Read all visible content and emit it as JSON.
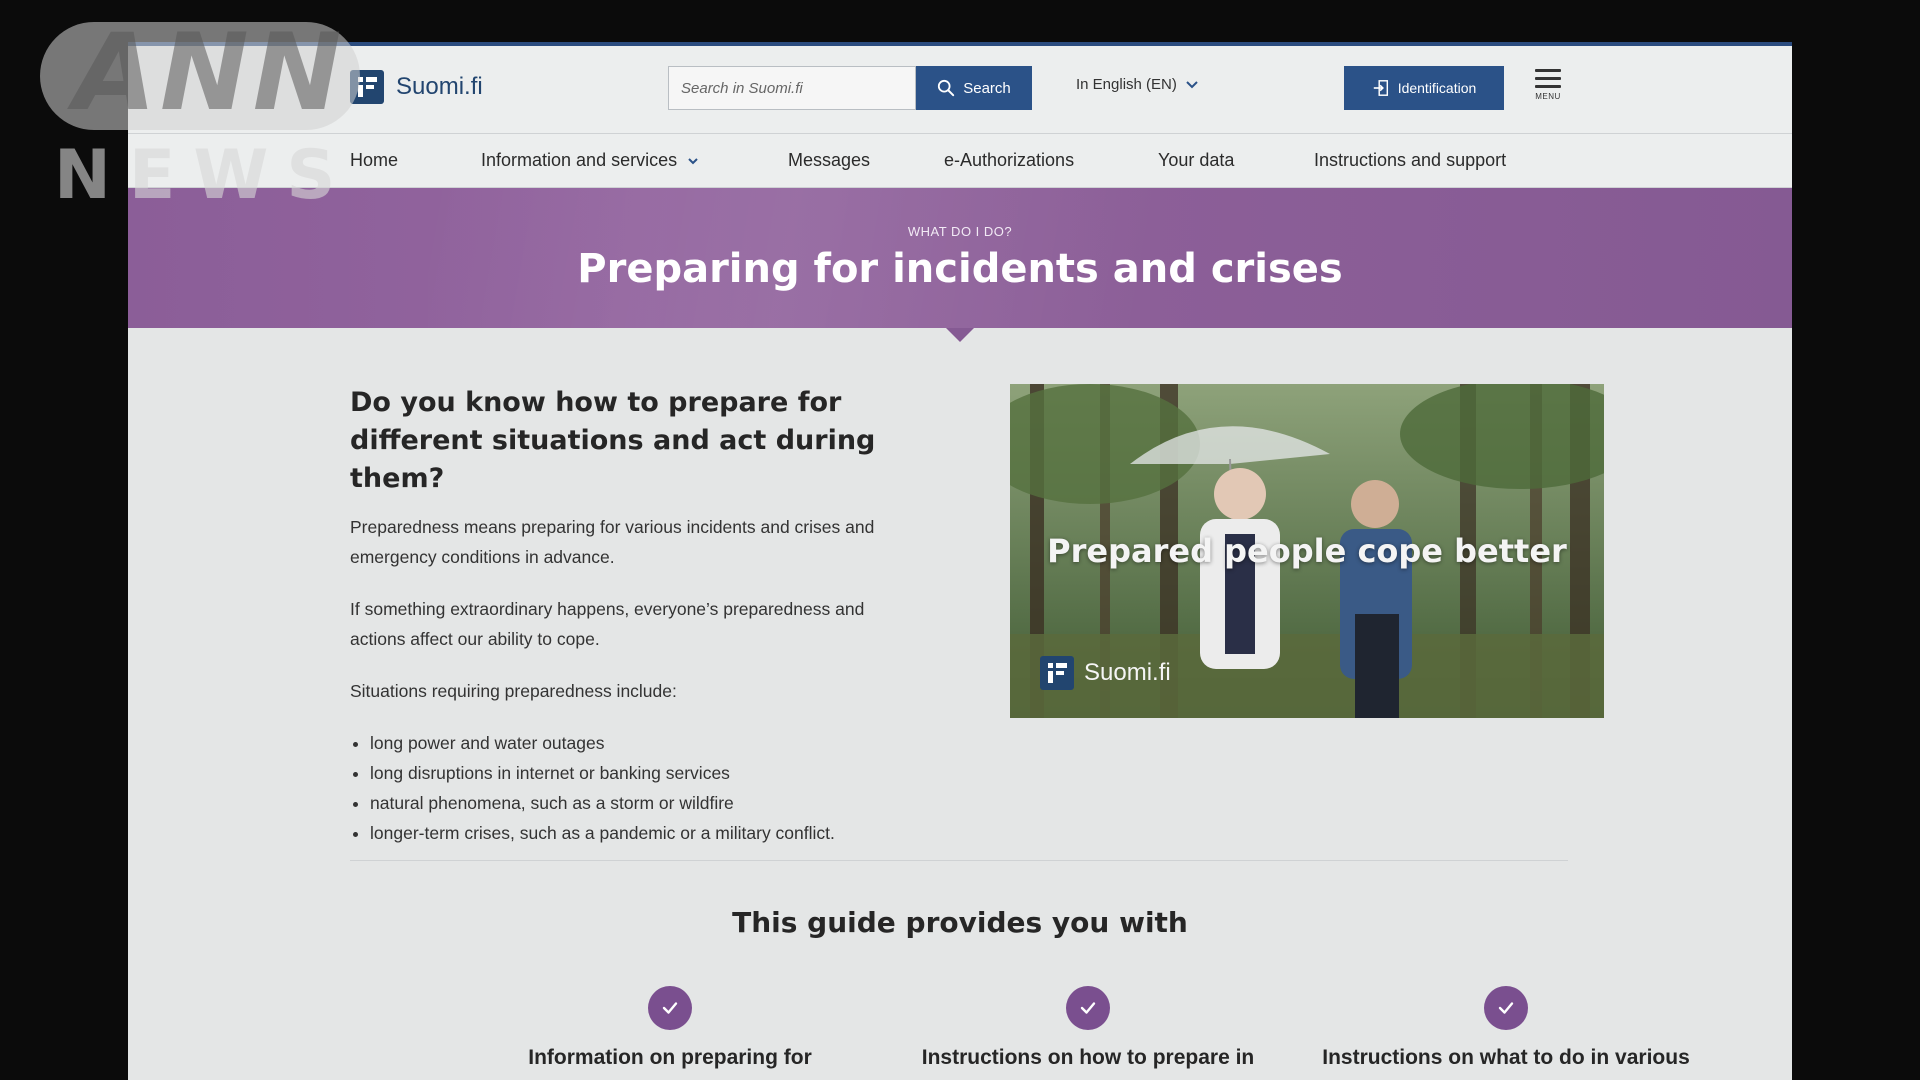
{
  "watermark": {
    "top": "ANN",
    "bottom": "NEWS"
  },
  "header": {
    "logo_text": "Suomi.fi",
    "search_placeholder": "Search in Suomi.fi",
    "search_button": "Search",
    "language": "In English (EN)",
    "identification_button": "Identification",
    "menu_label": "MENU"
  },
  "nav": {
    "items": [
      {
        "label": "Home"
      },
      {
        "label": "Information and services"
      },
      {
        "label": "Messages"
      },
      {
        "label": "e-Authorizations"
      },
      {
        "label": "Your data"
      },
      {
        "label": "Instructions and support"
      }
    ]
  },
  "hero": {
    "kicker": "WHAT DO I DO?",
    "title": "Preparing for incidents and crises"
  },
  "intro": {
    "heading": "Do you know how to prepare for different situations and act during them?",
    "paragraph1": "Preparedness means preparing for various incidents and crises and emergency conditions in advance.",
    "paragraph2": "If something extraordinary happens, everyone’s preparedness and actions affect our ability to cope.",
    "paragraph3": "Situations requiring preparedness include:",
    "list": [
      "long power and water outages",
      "long disruptions in internet or banking services",
      "natural phenomena, such as a storm or wildfire",
      "longer-term crises, such as a pandemic or a military conflict."
    ]
  },
  "feature": {
    "caption": "Prepared people cope better",
    "logo_text": "Suomi.fi"
  },
  "guide": {
    "title": "This guide provides you with",
    "items": [
      {
        "label": "Information on preparing for"
      },
      {
        "label": "Instructions on how to prepare in"
      },
      {
        "label": "Instructions on what to do in various"
      }
    ]
  },
  "colors": {
    "brand_blue": "#2b5288",
    "hero_purple": "#8b5e98",
    "check_purple": "#7a4f8f"
  }
}
